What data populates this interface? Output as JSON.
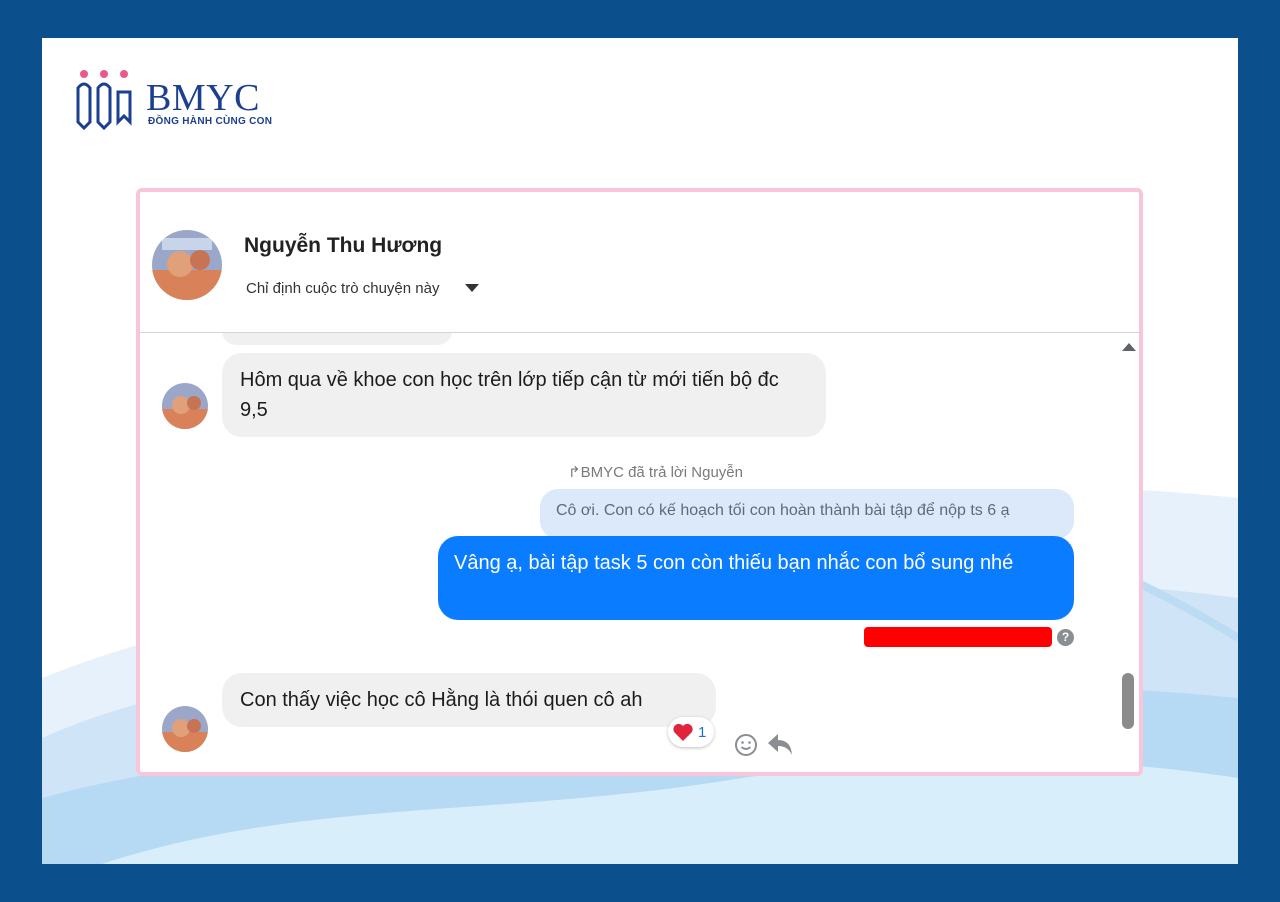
{
  "brand": {
    "name": "BMYC",
    "tagline": "ĐỒNG HÀNH CÙNG CON",
    "logo_icon": "three-figures-logo"
  },
  "conversation": {
    "contact_name": "Nguyễn Thu Hương",
    "assign_label": "Chỉ định cuộc trò chuyện này",
    "assign_icon": "caret-down-icon"
  },
  "messages": {
    "incoming_1": "Hôm qua về khoe con học trên lớp tiếp cận từ mới tiến bộ đc 9,5",
    "reply_note": "↱BMYC đã trả lời Nguyễn",
    "quoted_text": "Cô ơi. Con có kế hoạch tối con hoàn thành bài tập để nộp ts 6 ạ",
    "outgoing": "Vâng ạ, bài tập task 5 con còn thiếu bạn nhắc con bổ sung nhé",
    "help_glyph": "?",
    "incoming_2": "Con thấy việc học cô Hằng là thói quen cô ah",
    "reaction_count": "1"
  },
  "colors": {
    "page_border": "#0b4f8c",
    "card_border": "#f7c6da",
    "outgoing_bubble": "#0a7cff",
    "incoming_bubble": "#f0f0f0",
    "quoted_bubble": "#dbe9fb",
    "redaction": "#ff0000"
  }
}
